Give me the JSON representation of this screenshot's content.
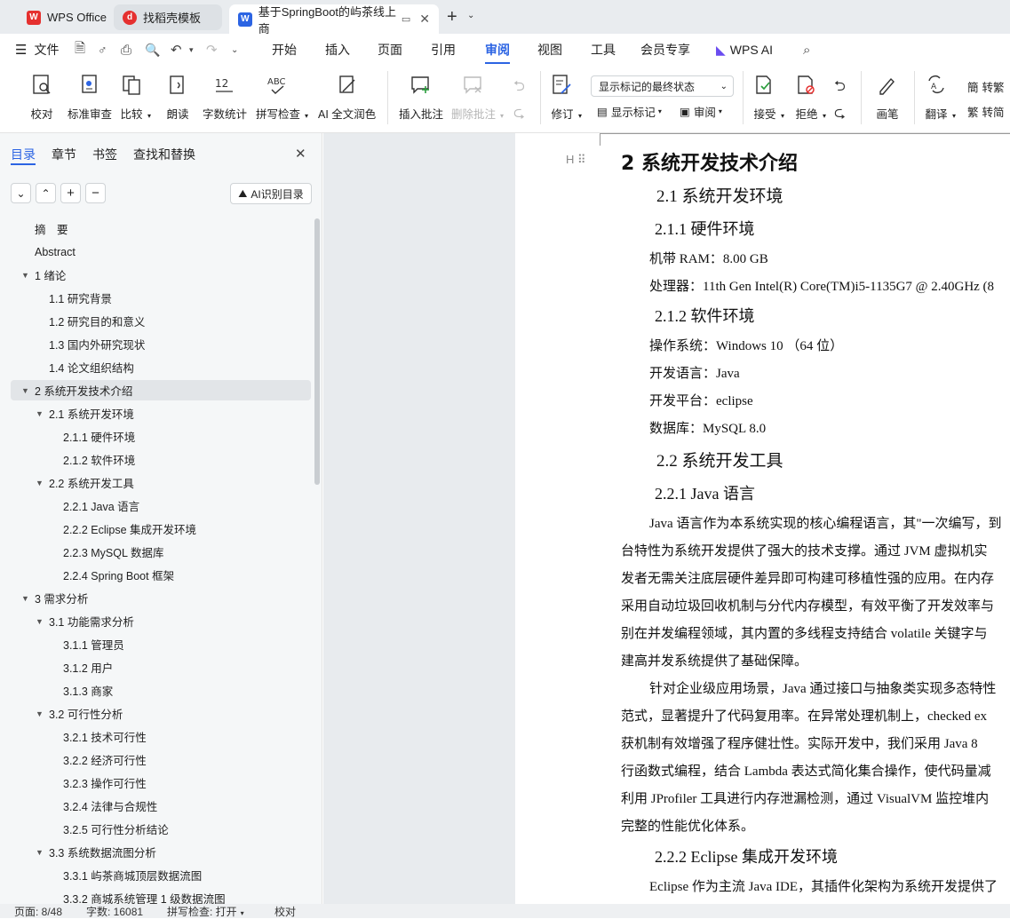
{
  "tabs": [
    {
      "label": "WPS Office"
    },
    {
      "label": "找稻壳模板"
    },
    {
      "label": "基于SpringBoot的屿茶线上商"
    }
  ],
  "menu": {
    "file": "文件",
    "items": [
      "开始",
      "插入",
      "页面",
      "引用",
      "审阅",
      "视图",
      "工具",
      "会员专享"
    ],
    "ai": "WPS AI"
  },
  "ribbon": {
    "proof": "校对",
    "std_review": "标准审查",
    "compare": "比较",
    "read": "朗读",
    "word_count": "字数统计",
    "spell": "拼写检查",
    "ai_polish": "AI 全文润色",
    "insert_comment": "插入批注",
    "delete_comment": "删除批注",
    "revise": "修订",
    "show_select": "显示标记的最终状态",
    "show_marks": "显示标记",
    "review": "审阅",
    "accept": "接受",
    "reject": "拒绝",
    "pen": "画笔",
    "translate": "翻译",
    "to_trad": "转繁",
    "to_simp": "转简"
  },
  "sidebar": {
    "tabs": [
      "目录",
      "章节",
      "书签",
      "查找和替换"
    ],
    "ai_toc": "AI识别目录",
    "items": [
      {
        "label": "摘　要"
      },
      {
        "label": "Abstract"
      },
      {
        "label": "1  绪论"
      },
      {
        "label": "1.1  研究背景"
      },
      {
        "label": "1.2  研究目的和意义"
      },
      {
        "label": "1.3  国内外研究现状"
      },
      {
        "label": "1.4  论文组织结构"
      },
      {
        "label": "2  系统开发技术介绍"
      },
      {
        "label": "2.1 系统开发环境"
      },
      {
        "label": "2.1.1  硬件环境"
      },
      {
        "label": "2.1.2  软件环境"
      },
      {
        "label": "2.2  系统开发工具"
      },
      {
        "label": "2.2.1 Java 语言"
      },
      {
        "label": "2.2.2 Eclipse 集成开发环境"
      },
      {
        "label": "2.2.3 MySQL 数据库"
      },
      {
        "label": "2.2.4 Spring Boot 框架"
      },
      {
        "label": "3  需求分析"
      },
      {
        "label": "3.1  功能需求分析"
      },
      {
        "label": "3.1.1  管理员"
      },
      {
        "label": "3.1.2  用户"
      },
      {
        "label": "3.1.3  商家"
      },
      {
        "label": "3.2 可行性分析"
      },
      {
        "label": "3.2.1  技术可行性"
      },
      {
        "label": "3.2.2  经济可行性"
      },
      {
        "label": "3.2.3  操作可行性"
      },
      {
        "label": "3.2.4  法律与合规性"
      },
      {
        "label": "3.2.5  可行性分析结论"
      },
      {
        "label": "3.3  系统数据流图分析"
      },
      {
        "label": "3.3.1 屿茶商城顶层数据流图"
      },
      {
        "label": "3.3.2  商城系统管理 1 级数据流图"
      }
    ]
  },
  "doc": {
    "h2": "2  系统开发技术介绍",
    "h21": "2.1 系统开发环境",
    "h211": "2.1.1  硬件环境",
    "ram": "机带  RAM：8.00 GB",
    "cpu": "处理器：11th Gen Intel(R) Core(TM)i5-1135G7 @ 2.40GHz (8",
    "h212": "2.1.2  软件环境",
    "os": "操作系统：Windows 10  （64 位）",
    "lang": "开发语言：Java",
    "platform": "开发平台：eclipse",
    "db": "数据库：MySQL 8.0",
    "h22": "2.2  系统开发工具",
    "h221": "2.2.1 Java 语言",
    "p1": [
      "Java 语言作为本系统实现的核心编程语言，其\"一次编写，到",
      "台特性为系统开发提供了强大的技术支撑。通过 JVM 虚拟机实",
      "发者无需关注底层硬件差异即可构建可移植性强的应用。在内存",
      "采用自动垃圾回收机制与分代内存模型，有效平衡了开发效率与",
      "别在并发编程领域，其内置的多线程支持结合 volatile 关键字与",
      "建高并发系统提供了基础保障。"
    ],
    "p2": [
      "针对企业级应用场景，Java 通过接口与抽象类实现多态特性",
      "范式，显著提升了代码复用率。在异常处理机制上，checked ex",
      "获机制有效增强了程序健壮性。实际开发中，我们采用 Java 8",
      "行函数式编程，结合 Lambda 表达式简化集合操作，使代码量减",
      "利用 JProfiler 工具进行内存泄漏检测，通过 VisualVM 监控堆内",
      "完整的性能优化体系。"
    ],
    "h222": "2.2.2 Eclipse 集成开发环境",
    "p3": "Eclipse 作为主流 Java IDE，其插件化架构为系统开发提供了"
  },
  "status": {
    "page": "页面: 8/48",
    "words": "字数: 16081",
    "spell": "拼写检查: 打开",
    "proof": "校对"
  }
}
